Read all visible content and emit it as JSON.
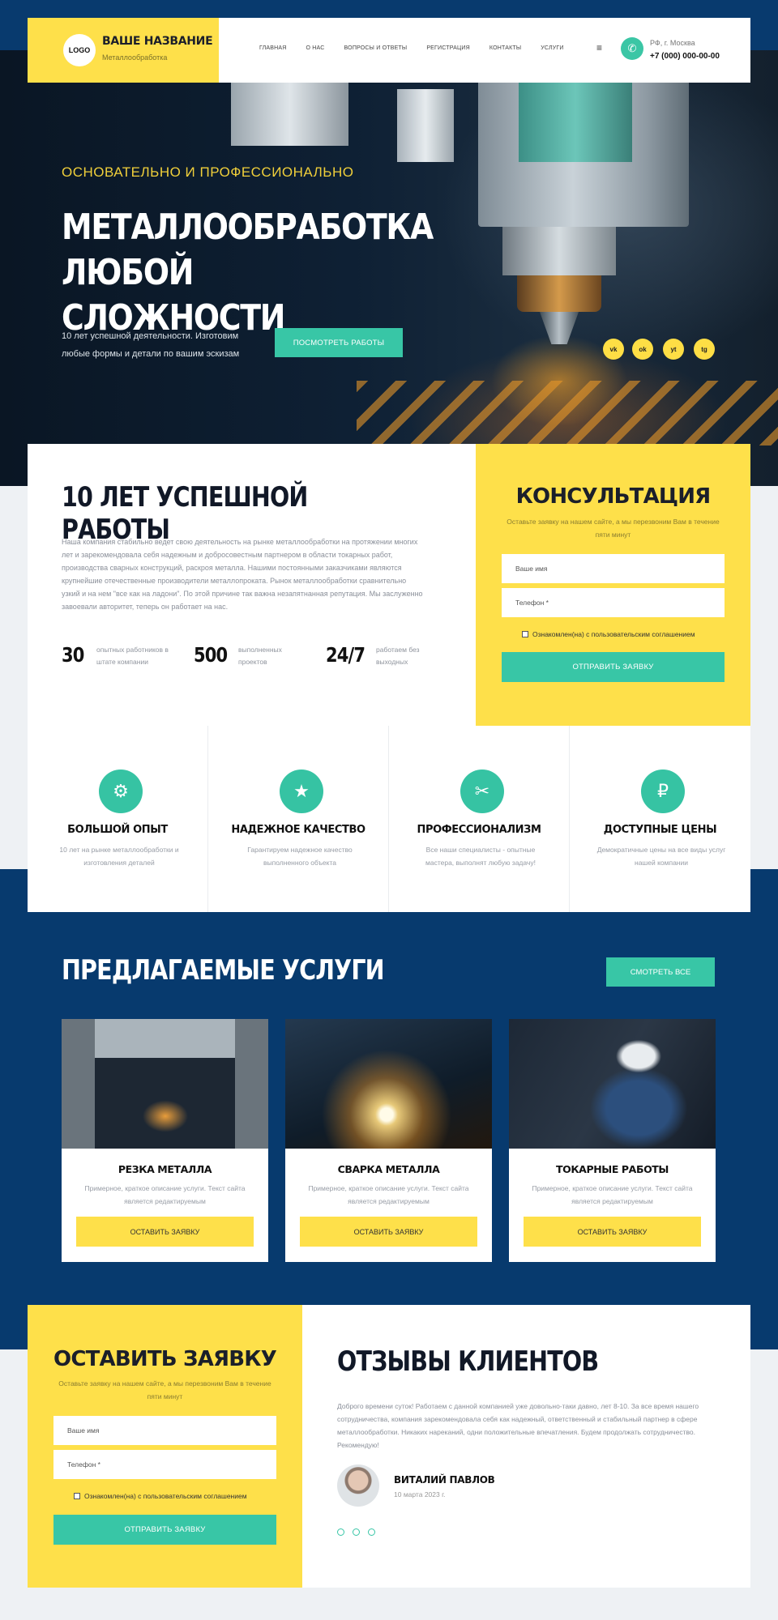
{
  "header": {
    "logo": "LOGO",
    "brand_name": "ВАШЕ НАЗВАНИЕ",
    "brand_sub": "Металлообработка",
    "nav": [
      "Главная",
      "О нас",
      "Вопросы и ответы",
      "Регистрация",
      "Контакты",
      "Услуги"
    ],
    "menu_icon": "≡",
    "city": "РФ, г. Москва",
    "phone": "+7 (000) 000-00-00",
    "phone_icon": "phone-icon"
  },
  "hero": {
    "kicker": "ОСНОВАТЕЛЬНО И ПРОФЕССИОНАЛЬНО",
    "title_line1": "МЕТАЛЛООБРАБОТКА",
    "title_line2": "ЛЮБОЙ СЛОЖНОСТИ",
    "description": "10 лет успешной деятельности. Изготовим любые формы и детали по вашим эскизам",
    "button": "ПОСМОТРЕТЬ РАБОТЫ",
    "social": [
      "vk",
      "ok",
      "yt",
      "tg"
    ]
  },
  "about": {
    "title": "10 ЛЕТ УСПЕШНОЙ РАБОТЫ",
    "text": "Наша компания стабильно ведет свою деятельность на рынке металлообработки на протяжении многих лет и зарекомендовала себя надежным и добросовестным партнером в области токарных работ, производства сварных конструкций, раскроя металла. Нашими постоянными заказчиками являются крупнейшие отечественные производители металлопроката. Рынок металлообработки сравнительно узкий и на нем \"все как на ладони\". По этой причине так важна незапятнанная репутация. Мы заслуженно завоевали авторитет, теперь он работает на нас.",
    "stats": [
      {
        "value": "30",
        "label": "опытных работников в штате компании"
      },
      {
        "value": "500",
        "label": "выполненных проектов"
      },
      {
        "value": "24/7",
        "label": "работаем без выходных"
      }
    ]
  },
  "consult": {
    "title": "КОНСУЛЬТАЦИЯ",
    "subtitle": "Оставьте заявку на нашем сайте, а мы перезвоним Вам в течение пяти минут",
    "name_placeholder": "Ваше имя",
    "phone_placeholder": "Телефон *",
    "agree": "Ознакомлен(на) с пользовательским соглашением",
    "button": "ОТПРАВИТЬ ЗАЯВКУ"
  },
  "features": [
    {
      "icon": "worker-helmet-icon",
      "glyph": "⚙",
      "title": "БОЛЬШОЙ ОПЫТ",
      "text": "10 лет на рынке металлообработки и изготовления деталей"
    },
    {
      "icon": "award-medal-icon",
      "glyph": "★",
      "title": "НАДЕЖНОЕ КАЧЕСТВО",
      "text": "Гарантируем надежное качество выполненного объекта"
    },
    {
      "icon": "tools-icon",
      "glyph": "✂",
      "title": "ПРОФЕССИОНАЛИЗМ",
      "text": "Все наши специалисты - опытные мастера, выполнят любую задачу!"
    },
    {
      "icon": "ruble-coins-icon",
      "glyph": "₽",
      "title": "ДОСТУПНЫЕ ЦЕНЫ",
      "text": "Демократичные цены на все виды услуг нашей компании"
    }
  ],
  "services": {
    "title": "ПРЕДЛАГАЕМЫЕ УСЛУГИ",
    "all_button": "СМОТРЕТЬ ВСЕ",
    "items": [
      {
        "title": "РЕЗКА МЕТАЛЛА",
        "text": "Примерное, краткое описание услуги. Текст сайта является редактируемым",
        "button": "ОСТАВИТЬ ЗАЯВКУ"
      },
      {
        "title": "СВАРКА МЕТАЛЛА",
        "text": "Примерное, краткое описание услуги. Текст сайта является редактируемым",
        "button": "ОСТАВИТЬ ЗАЯВКУ"
      },
      {
        "title": "ТОКАРНЫЕ РАБОТЫ",
        "text": "Примерное, краткое описание услуги. Текст сайта является редактируемым",
        "button": "ОСТАВИТЬ ЗАЯВКУ"
      }
    ]
  },
  "order": {
    "title": "ОСТАВИТЬ ЗАЯВКУ",
    "subtitle": "Оставьте заявку на нашем сайте, а мы перезвоним Вам в течение пяти минут",
    "name_placeholder": "Ваше имя",
    "phone_placeholder": "Телефон *",
    "agree": "Ознакомлен(на) с пользовательским соглашением",
    "button": "ОТПРАВИТЬ ЗАЯВКУ"
  },
  "reviews": {
    "title": "ОТЗЫВЫ КЛИЕНТОВ",
    "text": "Доброго времени суток! Работаем с данной компанией уже довольно-таки давно, лет 8-10. За все время нашего сотрудничества, компания зарекомендовала себя как надежный, ответственный и стабильный партнер в сфере металлообработки. Никаких нареканий, одни положительные впечатления. Будем продолжать сотрудничество. Рекомендую!",
    "name": "ВИТАЛИЙ ПАВЛОВ",
    "date": "10 марта 2023 г."
  },
  "colors": {
    "yellow": "#fee04a",
    "teal": "#38c6a6",
    "navy": "#073a6e"
  }
}
